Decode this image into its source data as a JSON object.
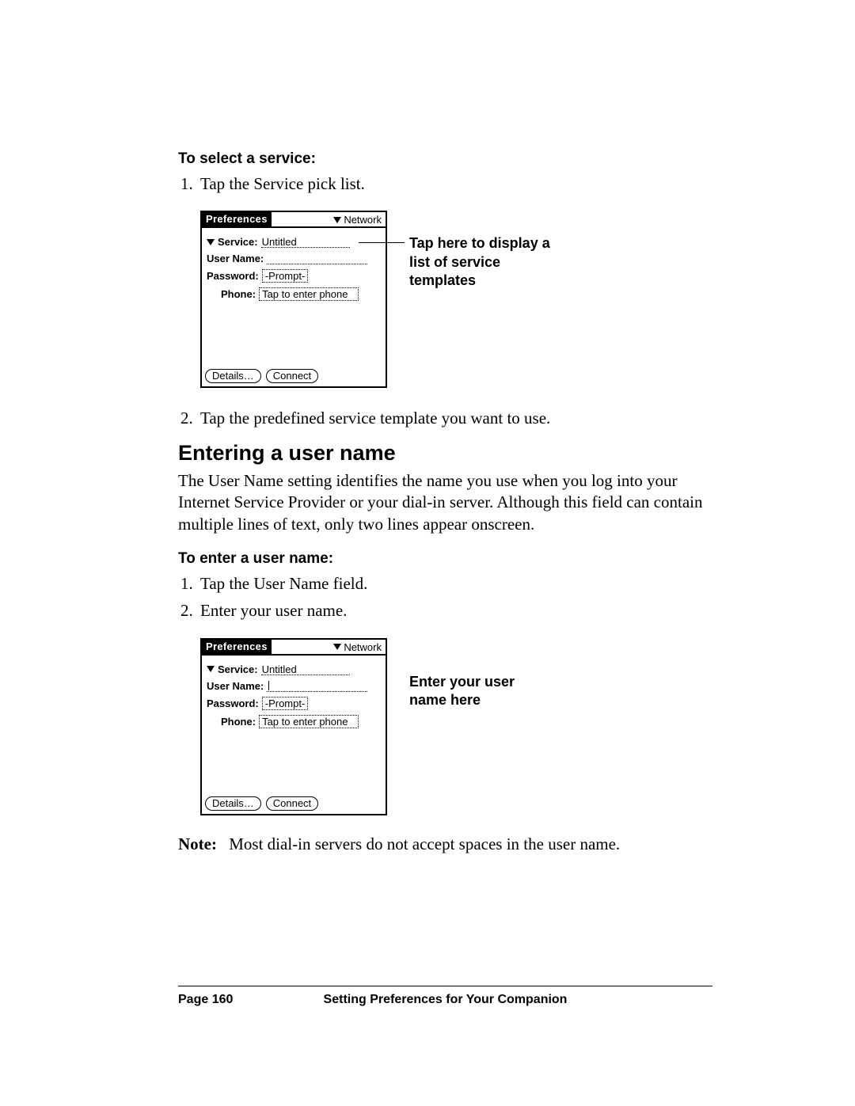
{
  "sec1": {
    "heading": "To select a service:",
    "step1": "Tap the Service pick list.",
    "step2": "Tap the predefined service template you want to use."
  },
  "fig1_callout": "Tap here to display a list of service templates",
  "h2": "Entering a user name",
  "para1": "The User Name setting identifies the name you use when you log into your Internet Service Provider or your dial-in server. Although this field can contain multiple lines of text, only two lines appear onscreen.",
  "sec2": {
    "heading": "To enter a user name:",
    "step1": "Tap the User Name field.",
    "step2": "Enter your user name."
  },
  "fig2_callout": "Enter your user name here",
  "note": {
    "label": "Note:",
    "text": "Most dial-in servers do not accept spaces in the user name."
  },
  "palm": {
    "title": "Preferences",
    "menu": "Network",
    "service_label": "Service:",
    "service_value": "Untitled",
    "username_label": "User Name:",
    "password_label": "Password:",
    "password_value": "-Prompt-",
    "phone_label": "Phone:",
    "phone_value": "Tap to enter phone",
    "btn_details": "Details…",
    "btn_connect": "Connect"
  },
  "footer": {
    "page": "Page 160",
    "chapter": "Setting Preferences for Your Companion"
  }
}
